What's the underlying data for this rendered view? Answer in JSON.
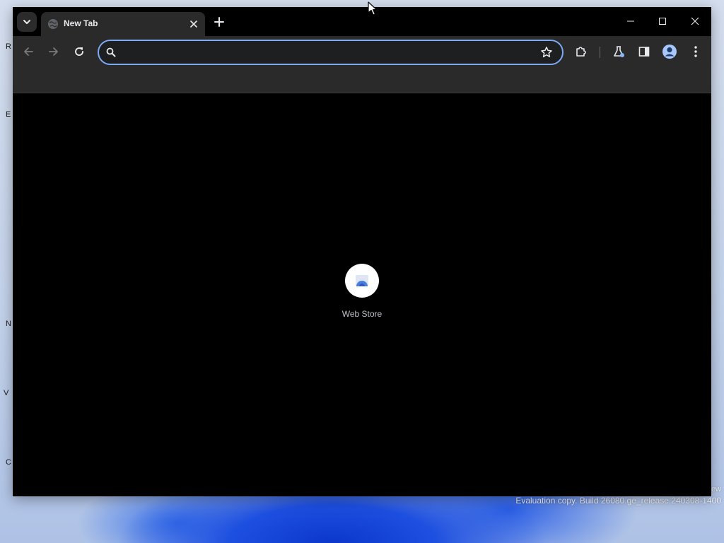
{
  "browser": {
    "tab": {
      "title": "New Tab",
      "favicon": "globe-icon",
      "close_icon": "close-icon"
    },
    "new_tab_icon": "plus-icon",
    "tab_search_icon": "chevron-down-icon",
    "window_controls": [
      "minimize-icon",
      "maximize-icon",
      "close-icon"
    ]
  },
  "toolbar": {
    "nav_icons": [
      "back-arrow-icon",
      "forward-arrow-icon",
      "reload-icon"
    ],
    "omnibox": {
      "value": "",
      "search_icon": "search-icon",
      "bookmark_icon": "star-icon"
    },
    "right_icons": [
      "extensions-puzzle-icon",
      "labs-flask-icon",
      "side-panel-icon",
      "profile-avatar-icon",
      "more-menu-icon"
    ]
  },
  "new_tab_page": {
    "shortcuts": [
      {
        "label": "Web Store",
        "icon": "web-store-icon"
      }
    ]
  },
  "desktop": {
    "watermark_line1": "ew",
    "watermark_line2": "Evaluation copy. Build 26080.ge_release.240308-1400"
  },
  "colors": {
    "toolbar_bg": "#2a2a2a",
    "omnibox_focus_border": "#7fa8f5",
    "content_bg": "#000000",
    "wallpaper_accent": "#1d4fe0"
  }
}
